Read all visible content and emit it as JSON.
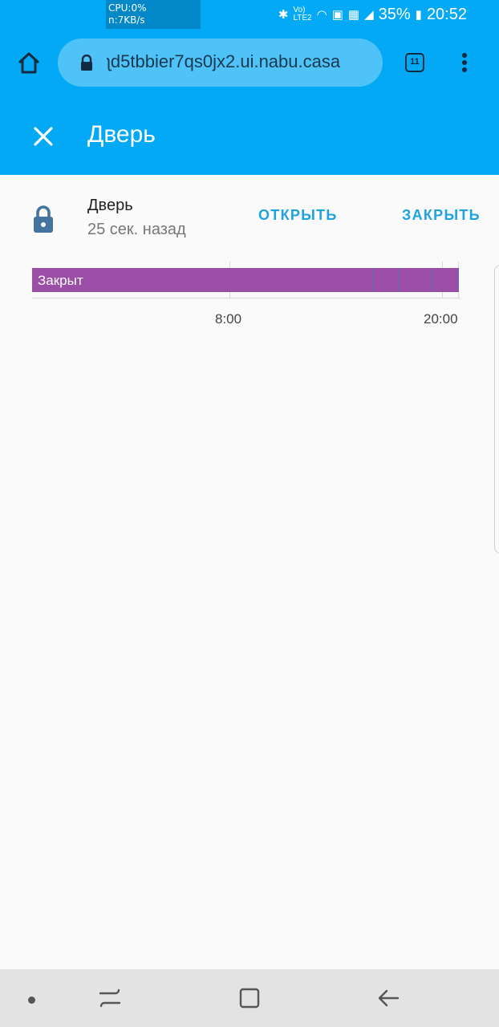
{
  "statusbar": {
    "cpu_line1": "CPU:0%",
    "cpu_line2": "n:7KB/s",
    "battery": "35%",
    "time": "20:52",
    "icons": [
      "bluetooth-icon",
      "volte-icon",
      "wifi-icon",
      "nfc-icon",
      "signal-r-icon",
      "signal-icon",
      "battery-icon"
    ]
  },
  "browser": {
    "url": "ʅd5tbbier7qs0jx2.ui.nabu.casa",
    "tab_count": "11",
    "icons": [
      "home-icon",
      "lock-icon",
      "tabs-icon",
      "more-vert-icon"
    ]
  },
  "dialog": {
    "title": "Дверь",
    "close_icon": "close-icon"
  },
  "entity": {
    "name": "Дверь",
    "last_changed": "25 сек. назад",
    "icon": "lock-icon",
    "open_label": "ОТКРЫТЬ",
    "close_label": "ЗАКРЫТЬ"
  },
  "timeline": {
    "state_label": "Закрыт",
    "bar_color": "#9b4ea6",
    "ticks": [
      "8:00",
      "20:00"
    ]
  },
  "colors": {
    "primary": "#03a9f4",
    "accent_button": "#1fa2e0",
    "state_closed": "#9b4ea6"
  },
  "navbar": {
    "icons": [
      "dot-icon",
      "recents-icon",
      "home-button-icon",
      "back-icon"
    ]
  }
}
